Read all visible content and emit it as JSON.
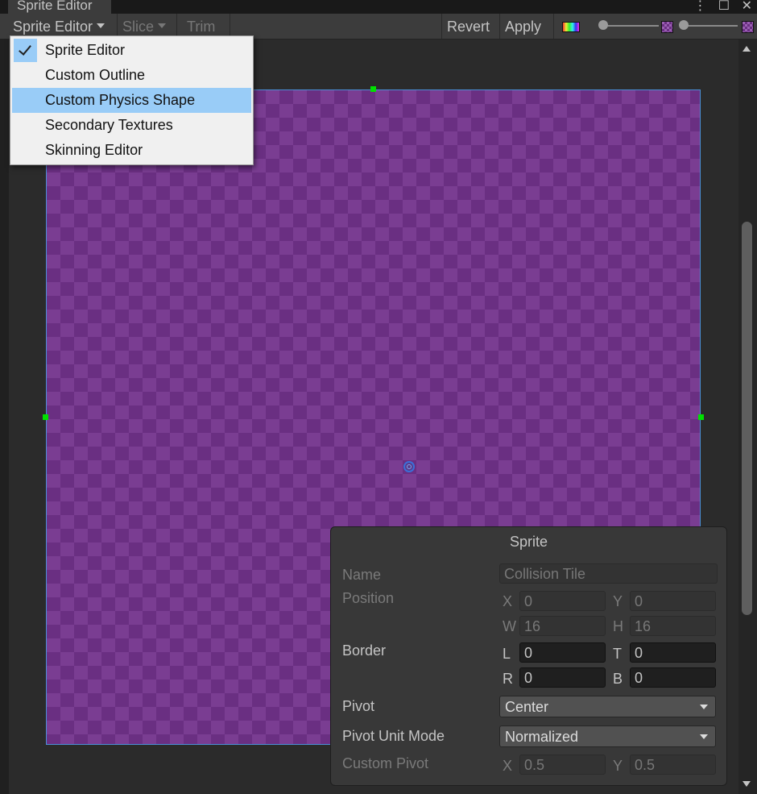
{
  "window": {
    "tab_title": "Sprite Editor",
    "menu_icon": "kebab-menu-icon",
    "maximize_icon": "maximize-icon",
    "close_icon": "close-icon"
  },
  "toolbar": {
    "mode_label": "Sprite Editor",
    "slice_label": "Slice",
    "trim_label": "Trim",
    "revert_label": "Revert",
    "apply_label": "Apply",
    "color_channel_icon": "rgb-channel-icon",
    "zoom_slider_value": 0,
    "mip_slider_value": 0
  },
  "mode_menu": {
    "items": [
      {
        "label": "Sprite Editor",
        "checked": true
      },
      {
        "label": "Custom Outline",
        "checked": false
      },
      {
        "label": "Custom Physics Shape",
        "checked": false,
        "hover": true
      },
      {
        "label": "Secondary Textures",
        "checked": false
      },
      {
        "label": "Skinning Editor",
        "checked": false
      }
    ]
  },
  "sprite_panel": {
    "title": "Sprite",
    "name_label": "Name",
    "name_value": "Collision Tile",
    "position_label": "Position",
    "position": {
      "x_label": "X",
      "x": "0",
      "y_label": "Y",
      "y": "0",
      "w_label": "W",
      "w": "16",
      "h_label": "H",
      "h": "16"
    },
    "border_label": "Border",
    "border": {
      "l_label": "L",
      "l": "0",
      "t_label": "T",
      "t": "0",
      "r_label": "R",
      "r": "0",
      "b_label": "B",
      "b": "0"
    },
    "pivot_label": "Pivot",
    "pivot_value": "Center",
    "pivot_unit_mode_label": "Pivot Unit Mode",
    "pivot_unit_mode_value": "Normalized",
    "custom_pivot_label": "Custom Pivot",
    "custom_pivot": {
      "x_label": "X",
      "x": "0.5",
      "y_label": "Y",
      "y": "0.5"
    }
  }
}
